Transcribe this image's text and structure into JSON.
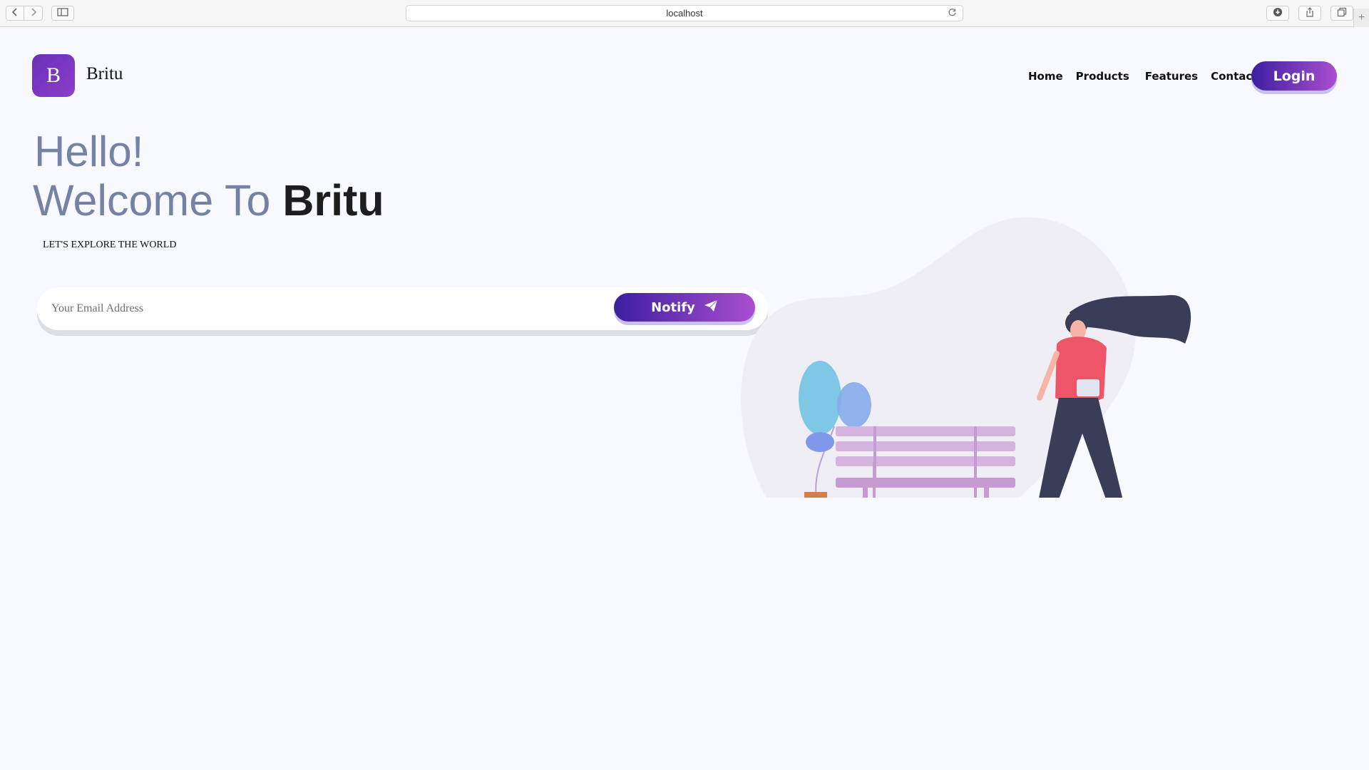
{
  "browser": {
    "url": "localhost"
  },
  "header": {
    "logo_letter": "B",
    "brand": "Britu",
    "nav": [
      "Home",
      "Products",
      "Features",
      "Contact"
    ],
    "login": "Login"
  },
  "hero": {
    "hello": "Hello!",
    "welcome_prefix": "Welcome To",
    "welcome_brand": "Britu",
    "tagline": "LET'S EXPLORE THE WORLD",
    "email_placeholder": "Your Email Address",
    "notify_label": "Notify"
  },
  "colors": {
    "accent_start": "#3c1fa0",
    "accent_end": "#a94fd0",
    "heading_muted": "#7482a4",
    "page_bg": "#f8f9fe"
  },
  "icons": [
    "back-icon",
    "forward-icon",
    "sidebar-icon",
    "reload-icon",
    "download-icon",
    "share-icon",
    "tabs-icon",
    "paper-plane-icon"
  ]
}
